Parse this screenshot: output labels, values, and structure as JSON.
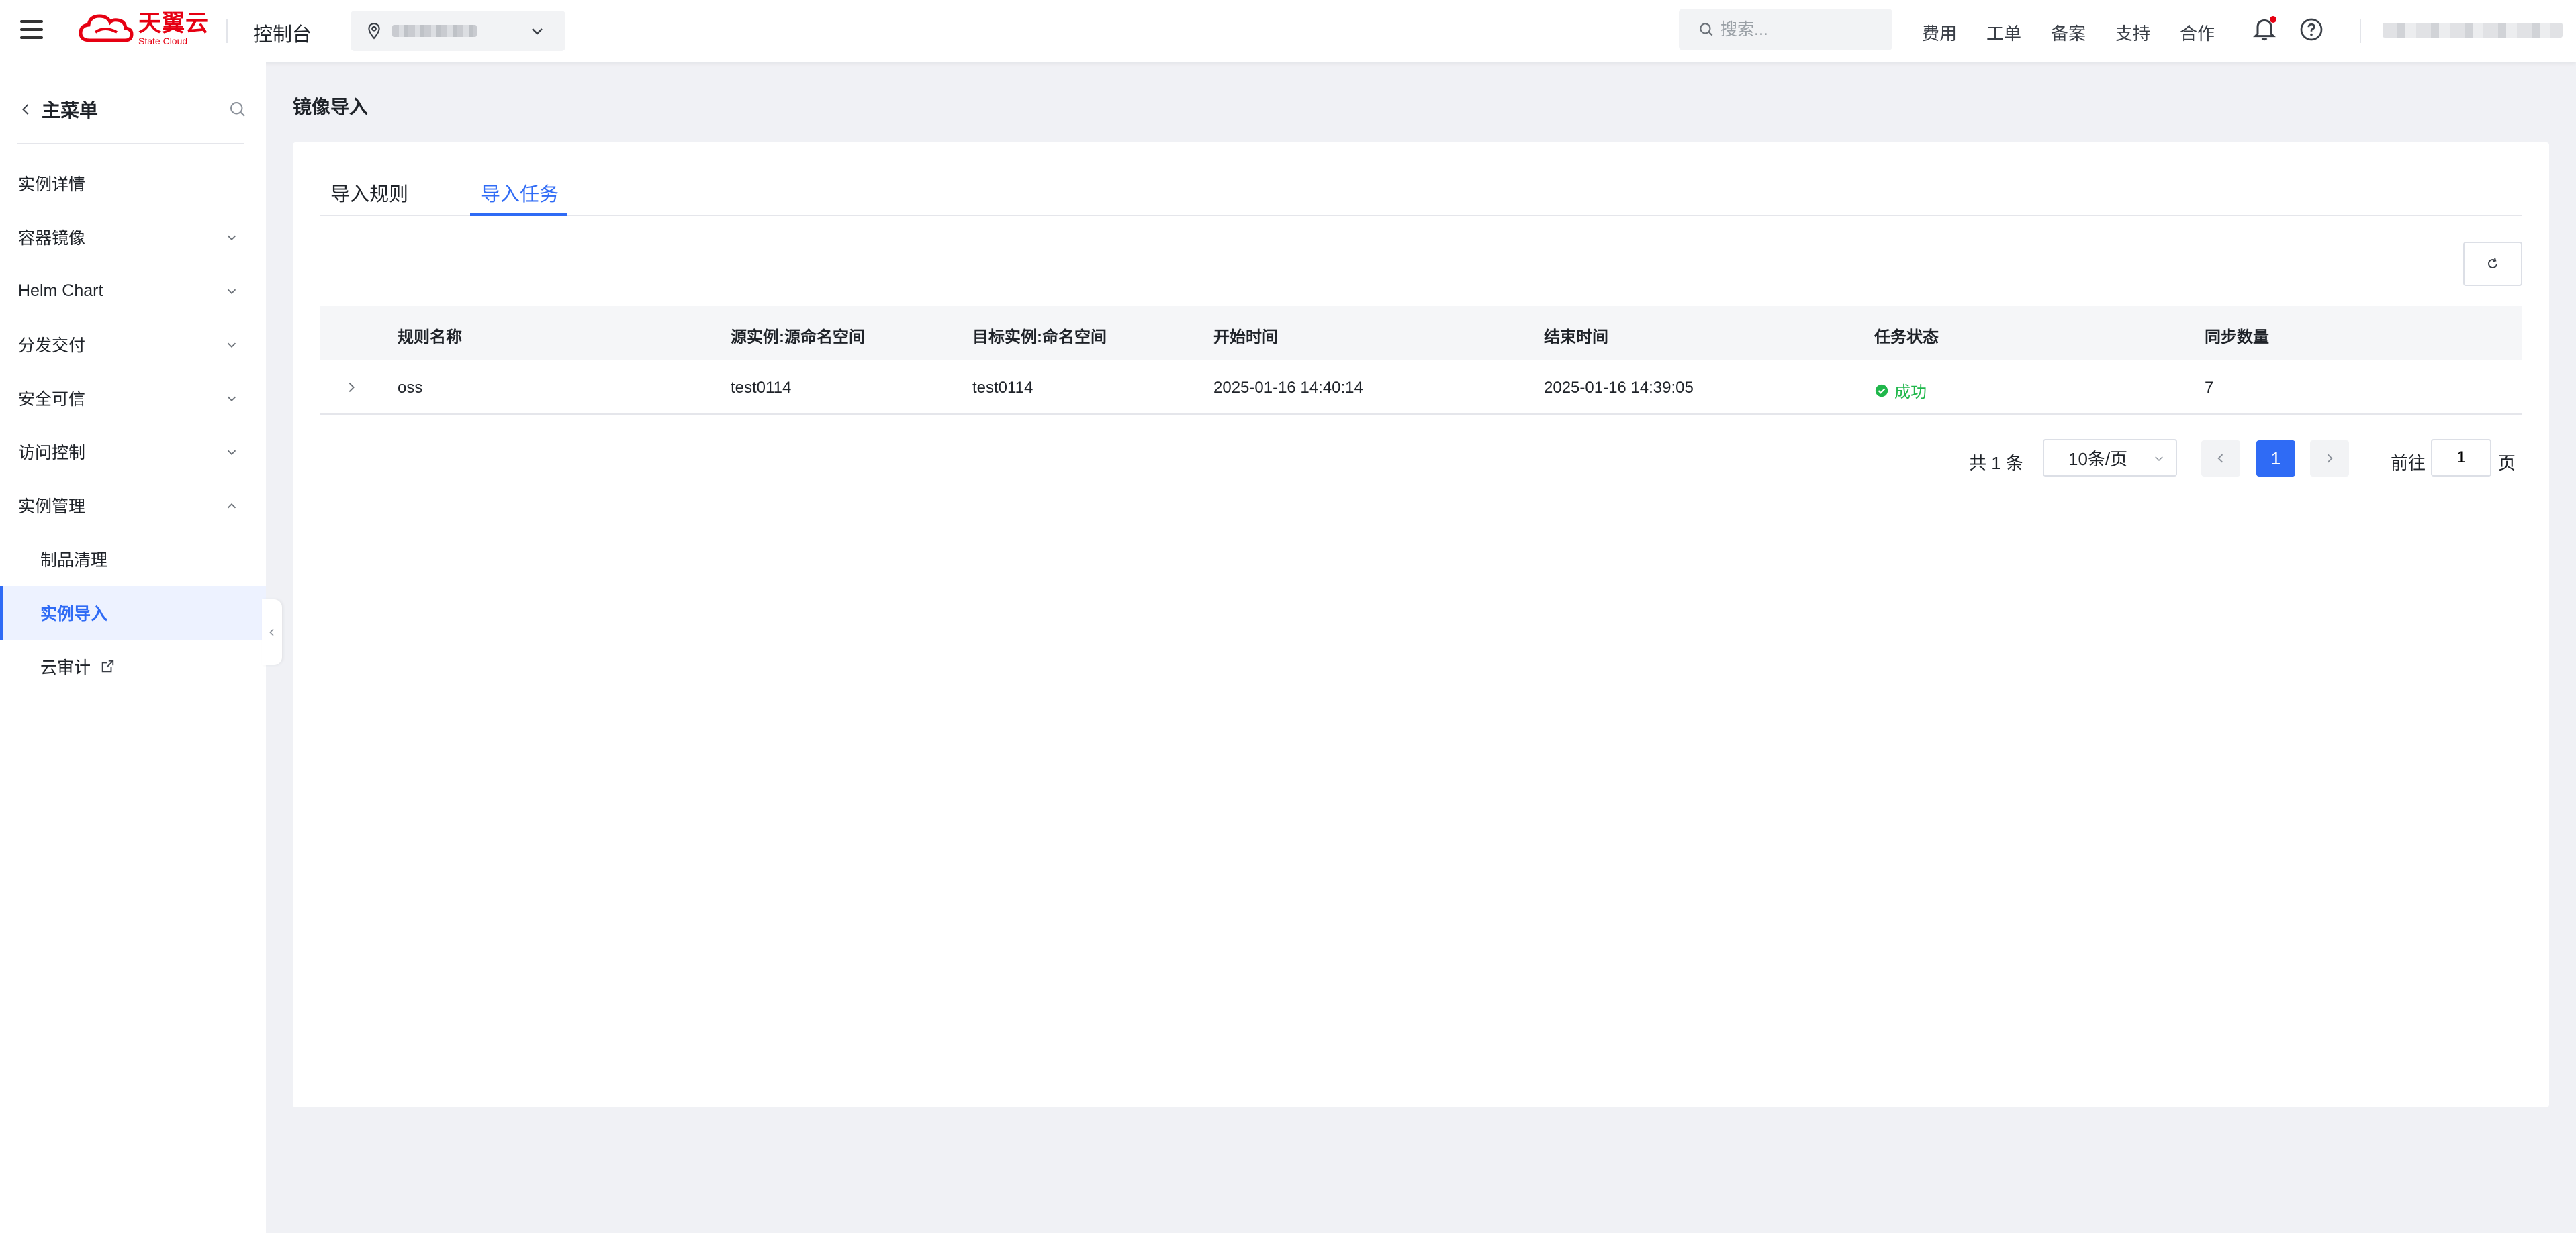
{
  "topbar": {
    "logo_cn": "天翼云",
    "logo_en": "State Cloud",
    "console_label": "控制台",
    "search_placeholder": "搜索...",
    "links": [
      "费用",
      "工单",
      "备案",
      "支持",
      "合作"
    ]
  },
  "sidebar": {
    "title": "主菜单",
    "items": [
      {
        "label": "实例详情",
        "caret": false
      },
      {
        "label": "容器镜像",
        "caret": "down"
      },
      {
        "label": "Helm Chart",
        "caret": "down"
      },
      {
        "label": "分发交付",
        "caret": "down"
      },
      {
        "label": "安全可信",
        "caret": "down"
      },
      {
        "label": "访问控制",
        "caret": "down"
      },
      {
        "label": "实例管理",
        "caret": "up"
      }
    ],
    "sub_items": [
      {
        "label": "制品清理"
      },
      {
        "label": "实例导入",
        "active": true
      },
      {
        "label": "云审计",
        "external": true
      }
    ]
  },
  "main": {
    "page_title": "镜像导入",
    "tabs": [
      {
        "label": "导入规则",
        "active": false
      },
      {
        "label": "导入任务",
        "active": true
      }
    ],
    "table": {
      "headers": [
        "规则名称",
        "源实例:源命名空间",
        "目标实例:命名空间",
        "开始时间",
        "结束时间",
        "任务状态",
        "同步数量"
      ],
      "rows": [
        {
          "rule_name": "oss",
          "source": "test0114",
          "target": "test0114",
          "start": "2025-01-16 14:40:14",
          "end": "2025-01-16 14:39:05",
          "status": "成功",
          "count": "7"
        }
      ]
    },
    "pagination": {
      "total": "共 1 条",
      "page_size": "10条/页",
      "current_page": "1",
      "goto_label": "前往",
      "goto_value": "1",
      "page_word": "页"
    }
  },
  "colors": {
    "accent": "#2f6bf5",
    "brand_red": "#e60012",
    "success": "#20b74b",
    "background": "#f0f1f5"
  },
  "icons": [
    "menu-icon",
    "cloud-logo-icon",
    "location-pin-icon",
    "chevron-down-icon",
    "search-icon",
    "bell-icon",
    "help-icon",
    "chevron-left-icon",
    "external-link-icon",
    "refresh-icon",
    "chevron-right-icon",
    "check-circle-icon"
  ]
}
